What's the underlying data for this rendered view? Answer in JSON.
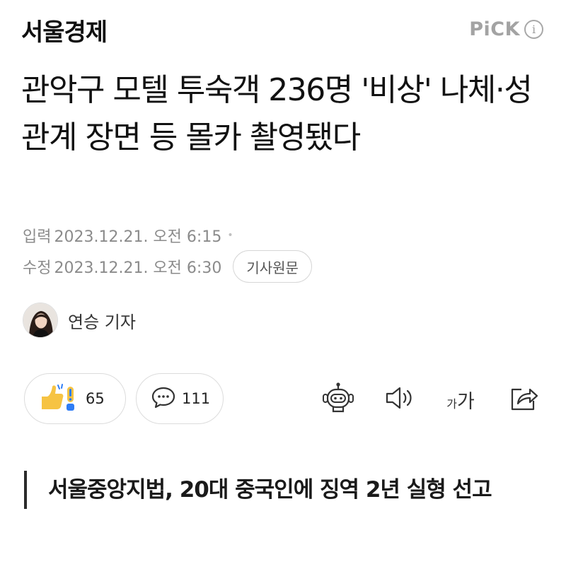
{
  "header": {
    "press_name": "서울경제",
    "pick_label": "PiCK",
    "info_icon": "info-icon"
  },
  "article": {
    "headline": "관악구 모텔 투숙객 236명 '비상' 나체·성관계 장면 등 몰카 촬영됐다",
    "input_label": "입력",
    "input_datetime": "2023.12.21. 오전 6:15",
    "modified_label": "수정",
    "modified_datetime": "2023.12.21. 오전 6:30",
    "original_button": "기사원문",
    "reporter": "연승 기자",
    "summary": "서울중앙지법, 20대 중국인에 징역 2년 실형 선고"
  },
  "actions": {
    "reaction_count": "65",
    "comment_count": "111",
    "font_small": "가",
    "font_big": "가",
    "icons": [
      "reaction-icon",
      "comment-icon",
      "robot-summary-icon",
      "speaker-icon",
      "font-size-icon",
      "share-icon"
    ]
  },
  "colors": {
    "text": "#111111",
    "meta": "#8b8b8b",
    "pick": "#a3a3a3",
    "reaction_yellow": "#f6c343",
    "reaction_blue": "#2f7df6"
  }
}
